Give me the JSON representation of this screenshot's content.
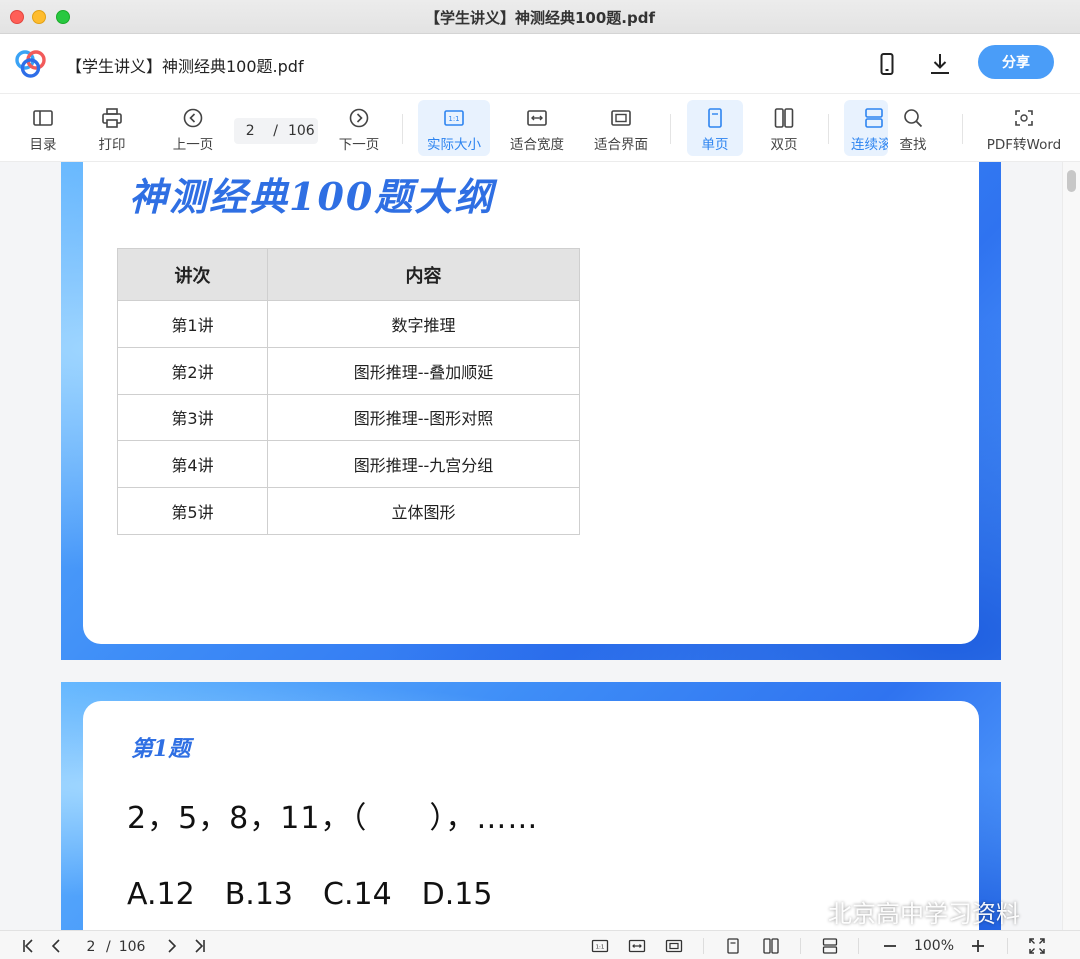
{
  "window": {
    "title": "【学生讲义】神测经典100题.pdf"
  },
  "header": {
    "doc_title": "【学生讲义】神测经典100题.pdf",
    "share_label": "分享"
  },
  "toolbar": {
    "toc": "目录",
    "print": "打印",
    "prev_page": "上一页",
    "current_page": "2",
    "page_sep": "/",
    "total_pages": "106",
    "next_page": "下一页",
    "actual_size": "实际大小",
    "fit_width": "适合宽度",
    "fit_page": "适合界面",
    "single_page": "单页",
    "double_page": "双页",
    "continuous": "连续滚",
    "find": "查找",
    "pdf_to_word": "PDF转Word"
  },
  "document": {
    "outline_title": "神测经典100题大纲",
    "table": {
      "headers": [
        "讲次",
        "内容"
      ],
      "rows": [
        [
          "第1讲",
          "数字推理"
        ],
        [
          "第2讲",
          "图形推理--叠加顺延"
        ],
        [
          "第3讲",
          "图形推理--图形对照"
        ],
        [
          "第4讲",
          "图形推理--九宫分组"
        ],
        [
          "第5讲",
          "立体图形"
        ]
      ]
    },
    "question_title": "第1题",
    "question_sequence": "2，5，8，11，（　　），……",
    "question_options": "A.12　B.13　C.14　D.15"
  },
  "watermark": {
    "text": "北京高中学习资料"
  },
  "statusbar": {
    "current_page": "2",
    "page_sep": "/",
    "total_pages": "106",
    "zoom": "100%"
  },
  "colors": {
    "accent": "#2d84f0",
    "share_button": "#4a9df8",
    "title_blue": "#2f6fe3"
  }
}
